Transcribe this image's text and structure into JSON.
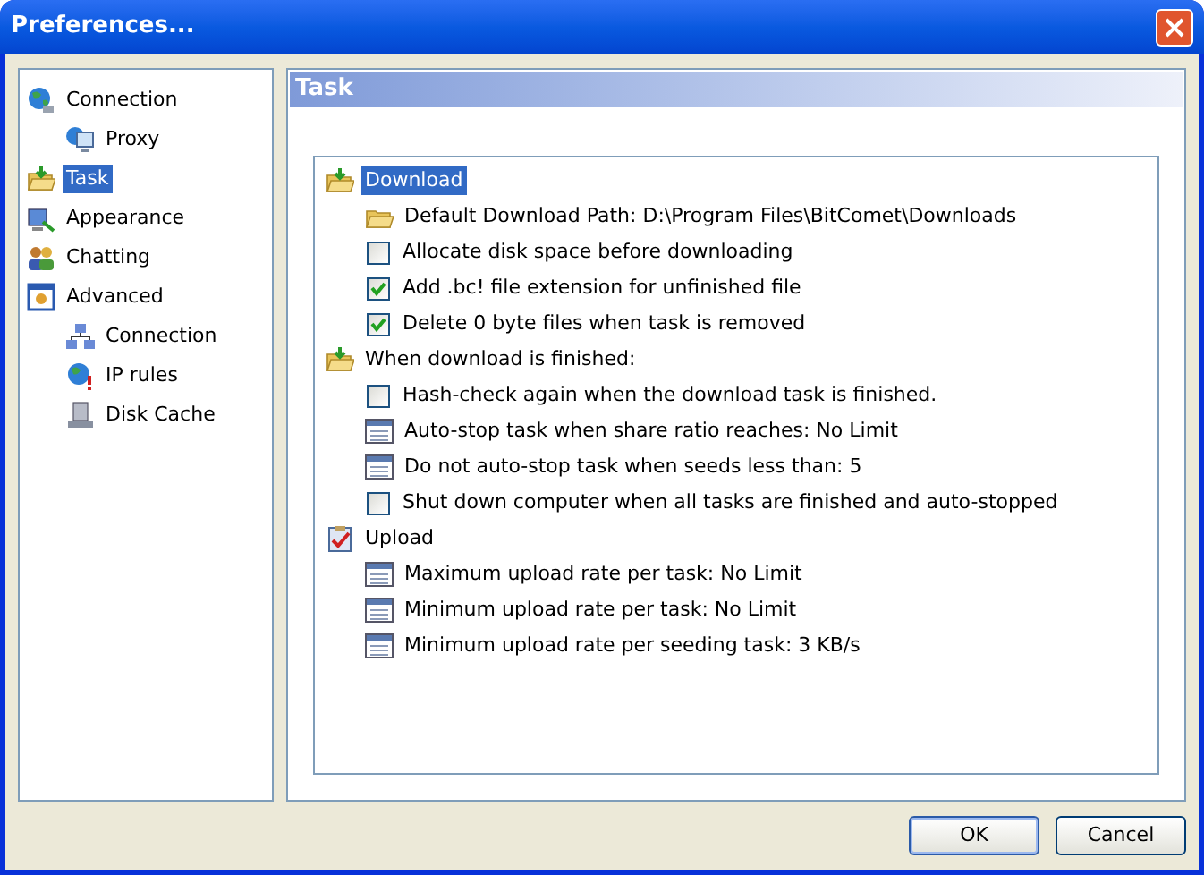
{
  "window": {
    "title": "Preferences..."
  },
  "sidebar": {
    "items": [
      {
        "label": "Connection",
        "selected": false,
        "children": [
          {
            "label": "Proxy",
            "selected": false
          }
        ]
      },
      {
        "label": "Task",
        "selected": true
      },
      {
        "label": "Appearance",
        "selected": false
      },
      {
        "label": "Chatting",
        "selected": false
      },
      {
        "label": "Advanced",
        "selected": false,
        "children": [
          {
            "label": "Connection",
            "selected": false
          },
          {
            "label": "IP rules",
            "selected": false
          },
          {
            "label": "Disk Cache",
            "selected": false
          }
        ]
      }
    ]
  },
  "panel": {
    "title": "Task",
    "groups": [
      {
        "label": "Download",
        "selected": true,
        "items": [
          {
            "kind": "path",
            "label": "Default Download Path: D:\\Program Files\\BitComet\\Downloads"
          },
          {
            "kind": "checkbox",
            "label": "Allocate disk space before downloading",
            "checked": false
          },
          {
            "kind": "checkbox",
            "label": "Add .bc! file extension for unfinished file",
            "checked": true
          },
          {
            "kind": "checkbox",
            "label": "Delete 0 byte files when task is removed",
            "checked": true
          }
        ]
      },
      {
        "label": "When download is finished:",
        "selected": false,
        "items": [
          {
            "kind": "checkbox",
            "label": "Hash-check again when the download task is finished.",
            "checked": false
          },
          {
            "kind": "setting",
            "label": "Auto-stop task when share ratio reaches: No Limit"
          },
          {
            "kind": "setting",
            "label": "Do not auto-stop task when seeds less than: 5"
          },
          {
            "kind": "checkbox",
            "label": "Shut down computer when all tasks are finished and auto-stopped",
            "checked": false
          }
        ]
      },
      {
        "label": "Upload",
        "selected": false,
        "items": [
          {
            "kind": "setting",
            "label": "Maximum upload rate per task: No Limit"
          },
          {
            "kind": "setting",
            "label": "Minimum upload rate per task: No Limit"
          },
          {
            "kind": "setting",
            "label": "Minimum upload rate per seeding task: 3 KB/s"
          }
        ]
      }
    ]
  },
  "buttons": [
    "OK",
    "Cancel"
  ]
}
